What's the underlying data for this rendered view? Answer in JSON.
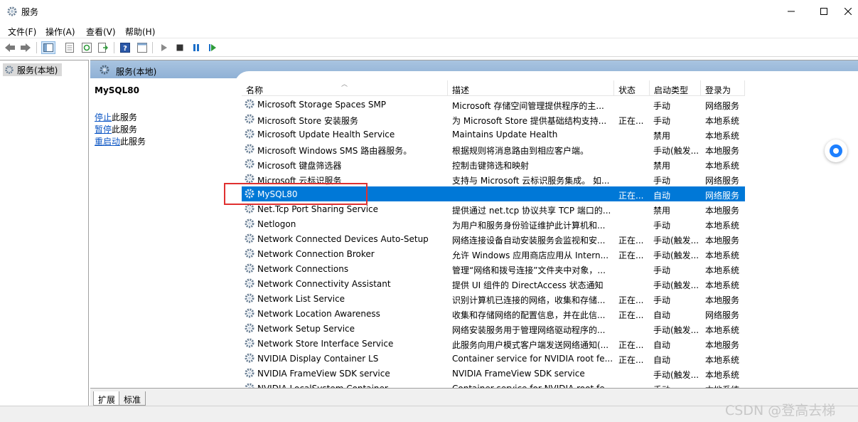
{
  "window": {
    "title": "服务"
  },
  "menu": [
    "文件(F)",
    "操作(A)",
    "查看(V)",
    "帮助(H)"
  ],
  "tree": {
    "root_label": "服务(本地)"
  },
  "pane": {
    "header": "服务(本地)",
    "selected_service": "MySQL80",
    "actions": [
      {
        "link": "停止",
        "suffix": "此服务"
      },
      {
        "link": "暂停",
        "suffix": "此服务"
      },
      {
        "link": "重启动",
        "suffix": "此服务"
      }
    ]
  },
  "table": {
    "columns": [
      "名称",
      "描述",
      "状态",
      "启动类型",
      "登录为"
    ],
    "rows": [
      {
        "name": "Microsoft Storage Spaces SMP",
        "desc": "Microsoft 存储空间管理提供程序的主...",
        "status": "",
        "startup": "手动",
        "logon": "网络服务"
      },
      {
        "name": "Microsoft Store 安装服务",
        "desc": "为 Microsoft Store 提供基础结构支持...",
        "status": "正在...",
        "startup": "手动",
        "logon": "本地系统"
      },
      {
        "name": "Microsoft Update Health Service",
        "desc": "Maintains Update Health",
        "status": "",
        "startup": "禁用",
        "logon": "本地系统"
      },
      {
        "name": "Microsoft Windows SMS 路由器服务。",
        "desc": "根据规则将消息路由到相应客户端。",
        "status": "",
        "startup": "手动(触发...",
        "logon": "本地服务"
      },
      {
        "name": "Microsoft 键盘筛选器",
        "desc": "控制击键筛选和映射",
        "status": "",
        "startup": "禁用",
        "logon": "本地系统"
      },
      {
        "name": "Microsoft 云标识服务",
        "desc": "支持与 Microsoft 云标识服务集成。 如...",
        "status": "",
        "startup": "手动",
        "logon": "网络服务"
      },
      {
        "name": "MySQL80",
        "desc": "",
        "status": "正在...",
        "startup": "自动",
        "logon": "网络服务",
        "selected": true
      },
      {
        "name": "Net.Tcp Port Sharing Service",
        "desc": "提供通过 net.tcp 协议共享 TCP 端口的...",
        "status": "",
        "startup": "禁用",
        "logon": "本地服务"
      },
      {
        "name": "Netlogon",
        "desc": "为用户和服务身份验证维护此计算机和...",
        "status": "",
        "startup": "手动",
        "logon": "本地系统"
      },
      {
        "name": "Network Connected Devices Auto-Setup",
        "desc": "网络连接设备自动安装服务会监视和安...",
        "status": "正在...",
        "startup": "手动(触发...",
        "logon": "本地服务"
      },
      {
        "name": "Network Connection Broker",
        "desc": "允许 Windows 应用商店应用从 Intern...",
        "status": "正在...",
        "startup": "手动(触发...",
        "logon": "本地系统"
      },
      {
        "name": "Network Connections",
        "desc": "管理“网络和拨号连接”文件夹中对象，...",
        "status": "",
        "startup": "手动",
        "logon": "本地系统"
      },
      {
        "name": "Network Connectivity Assistant",
        "desc": "提供 UI 组件的 DirectAccess 状态通知",
        "status": "",
        "startup": "手动(触发...",
        "logon": "本地系统"
      },
      {
        "name": "Network List Service",
        "desc": "识别计算机已连接的网络，收集和存储...",
        "status": "正在...",
        "startup": "手动",
        "logon": "本地服务"
      },
      {
        "name": "Network Location Awareness",
        "desc": "收集和存储网络的配置信息，并在此信...",
        "status": "正在...",
        "startup": "自动",
        "logon": "网络服务"
      },
      {
        "name": "Network Setup Service",
        "desc": "网络安装服务用于管理网络驱动程序的...",
        "status": "",
        "startup": "手动(触发...",
        "logon": "本地系统"
      },
      {
        "name": "Network Store Interface Service",
        "desc": "此服务向用户模式客户端发送网络通知(...",
        "status": "正在...",
        "startup": "自动",
        "logon": "本地服务"
      },
      {
        "name": "NVIDIA Display Container LS",
        "desc": "Container service for NVIDIA root fe...",
        "status": "正在...",
        "startup": "自动",
        "logon": "本地系统"
      },
      {
        "name": "NVIDIA FrameView SDK service",
        "desc": "NVIDIA FrameView SDK service",
        "status": "",
        "startup": "手动(触发...",
        "logon": "本地系统"
      },
      {
        "name": "NVIDIA LocalSystem Container",
        "desc": "Container service for NVIDIA root fe...",
        "status": "",
        "startup": "手动",
        "logon": "本地系统"
      }
    ]
  },
  "tabs": [
    "扩展",
    "标准"
  ],
  "watermark": "CSDN @登高去梯",
  "colors": {
    "selection": "#0078d7",
    "highlight": "#e03030",
    "link": "#0b55c4"
  }
}
